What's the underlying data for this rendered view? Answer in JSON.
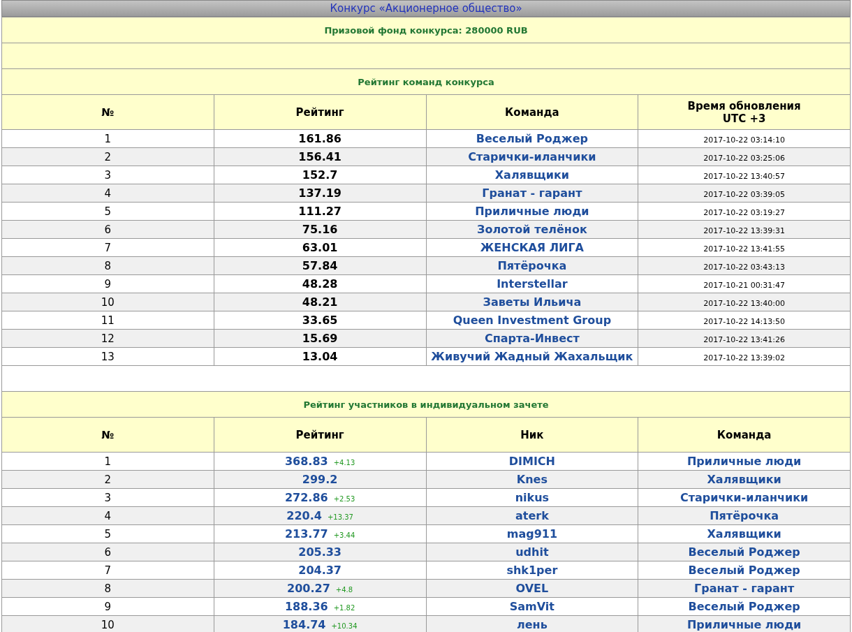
{
  "title": "Конкурс «Акционерное общество»",
  "prize_fund": "Призовой фонд конкурса: 280000 RUB",
  "team_rating": {
    "title": "Рейтинг команд конкурса",
    "columns": [
      "№",
      "Рейтинг",
      "Команда",
      "Время обновления\nUTC +3"
    ],
    "rows": [
      {
        "place": "1",
        "rating": "161.86",
        "team": "Веселый Роджер",
        "updated": "2017-10-22 03:14:10"
      },
      {
        "place": "2",
        "rating": "156.41",
        "team": "Старички-иланчики",
        "updated": "2017-10-22 03:25:06"
      },
      {
        "place": "3",
        "rating": "152.7",
        "team": "Халявщики",
        "updated": "2017-10-22 13:40:57"
      },
      {
        "place": "4",
        "rating": "137.19",
        "team": "Гранат - гарант",
        "updated": "2017-10-22 03:39:05"
      },
      {
        "place": "5",
        "rating": "111.27",
        "team": "Приличные люди",
        "updated": "2017-10-22 03:19:27"
      },
      {
        "place": "6",
        "rating": "75.16",
        "team": "Золотой телёнок",
        "updated": "2017-10-22 13:39:31"
      },
      {
        "place": "7",
        "rating": "63.01",
        "team": "ЖЕНСКАЯ ЛИГА",
        "updated": "2017-10-22 13:41:55"
      },
      {
        "place": "8",
        "rating": "57.84",
        "team": "Пятёрочка",
        "updated": "2017-10-22 03:43:13"
      },
      {
        "place": "9",
        "rating": "48.28",
        "team": "Interstellar",
        "updated": "2017-10-21 00:31:47"
      },
      {
        "place": "10",
        "rating": "48.21",
        "team": "Заветы Ильича",
        "updated": "2017-10-22 13:40:00"
      },
      {
        "place": "11",
        "rating": "33.65",
        "team": "Queen Investment Group",
        "updated": "2017-10-22 14:13:50"
      },
      {
        "place": "12",
        "rating": "15.69",
        "team": "Спарта-Инвест",
        "updated": "2017-10-22 13:41:26"
      },
      {
        "place": "13",
        "rating": "13.04",
        "team": "Живучий Жадный Жахальщик",
        "updated": "2017-10-22 13:39:02"
      }
    ]
  },
  "individual_rating": {
    "title": "Рейтинг участников в индивидуальном зачете",
    "columns": [
      "№",
      "Рейтинг",
      "Ник",
      "Команда"
    ],
    "rows": [
      {
        "place": "1",
        "rating": "368.83",
        "change": "+4.13",
        "nick": "DIMICH",
        "team": "Приличные люди"
      },
      {
        "place": "2",
        "rating": "299.2",
        "nick": "Knes",
        "team": "Халявщики"
      },
      {
        "place": "3",
        "rating": "272.86",
        "change": "+2.53",
        "nick": "nikus",
        "team": "Старички-иланчики"
      },
      {
        "place": "4",
        "rating": "220.4",
        "change": "+13.37",
        "nick": "aterk",
        "team": "Пятёрочка"
      },
      {
        "place": "5",
        "rating": "213.77",
        "change": "+3.44",
        "nick": "mag911",
        "team": "Халявщики"
      },
      {
        "place": "6",
        "rating": "205.33",
        "nick": "udhit",
        "team": "Веселый Роджер"
      },
      {
        "place": "7",
        "rating": "204.37",
        "nick": "shk1per",
        "team": "Веселый Роджер"
      },
      {
        "place": "8",
        "rating": "200.27",
        "change": "+4.8",
        "nick": "OVEL",
        "team": "Гранат - гарант"
      },
      {
        "place": "9",
        "rating": "188.36",
        "change": "+1.82",
        "nick": "SamVit",
        "team": "Веселый Роджер"
      },
      {
        "place": "10",
        "rating": "184.74",
        "change": "+10.34",
        "nick": "лень",
        "team": "Приличные люди"
      }
    ]
  }
}
